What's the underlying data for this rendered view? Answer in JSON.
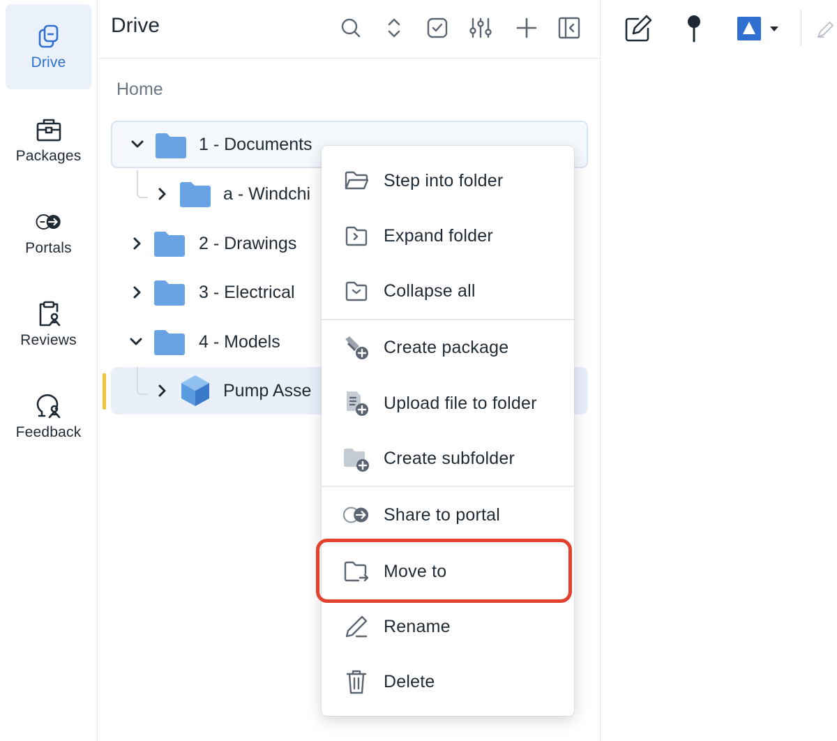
{
  "rail": {
    "items": [
      {
        "label": "Drive",
        "icon": "drive-icon",
        "active": true
      },
      {
        "label": "Packages",
        "icon": "briefcase-icon"
      },
      {
        "label": "Portals",
        "icon": "portal-icon"
      },
      {
        "label": "Reviews",
        "icon": "review-clipboard-icon"
      },
      {
        "label": "Feedback",
        "icon": "feedback-icon"
      }
    ]
  },
  "header": {
    "title": "Drive",
    "actions": [
      "search-icon",
      "expand-collapse-icon",
      "checkbox-icon",
      "filter-sliders-icon",
      "plus-icon",
      "collapse-panel-icon"
    ]
  },
  "breadcrumb": "Home",
  "tree": [
    {
      "label": "1 - Documents",
      "expanded": true,
      "level": 0
    },
    {
      "label": "a - Windchi",
      "expanded": false,
      "level": 1
    },
    {
      "label": "2 - Drawings",
      "expanded": false,
      "level": 0
    },
    {
      "label": "3 - Electrical",
      "expanded": false,
      "level": 0
    },
    {
      "label": "4 - Models",
      "expanded": true,
      "level": 0
    },
    {
      "label": "Pump Asse",
      "expanded": false,
      "level": 1,
      "type": "model"
    }
  ],
  "right_toolbar": [
    "edit-note-icon",
    "pin-icon",
    "shape-picker-icon",
    "pen-icon"
  ],
  "colors": {
    "accent": "#2f6fcf",
    "folder": "#6aa3e4",
    "highlight": "#e2412e",
    "selection_mark": "#f0c53a"
  },
  "menu": {
    "items": [
      {
        "label": "Step into folder",
        "icon": "folder-open-icon"
      },
      {
        "label": "Expand folder",
        "icon": "folder-expand-icon"
      },
      {
        "label": "Collapse all",
        "icon": "folder-collapse-icon"
      },
      {
        "label": "Create package",
        "icon": "create-package-icon"
      },
      {
        "label": "Upload file to folder",
        "icon": "upload-file-icon"
      },
      {
        "label": "Create subfolder",
        "icon": "create-subfolder-icon"
      },
      {
        "label": "Share to portal",
        "icon": "share-portal-icon"
      },
      {
        "label": "Move to",
        "icon": "move-to-icon",
        "highlighted": true
      },
      {
        "label": "Rename",
        "icon": "rename-pencil-icon"
      },
      {
        "label": "Delete",
        "icon": "trash-icon"
      }
    ]
  }
}
